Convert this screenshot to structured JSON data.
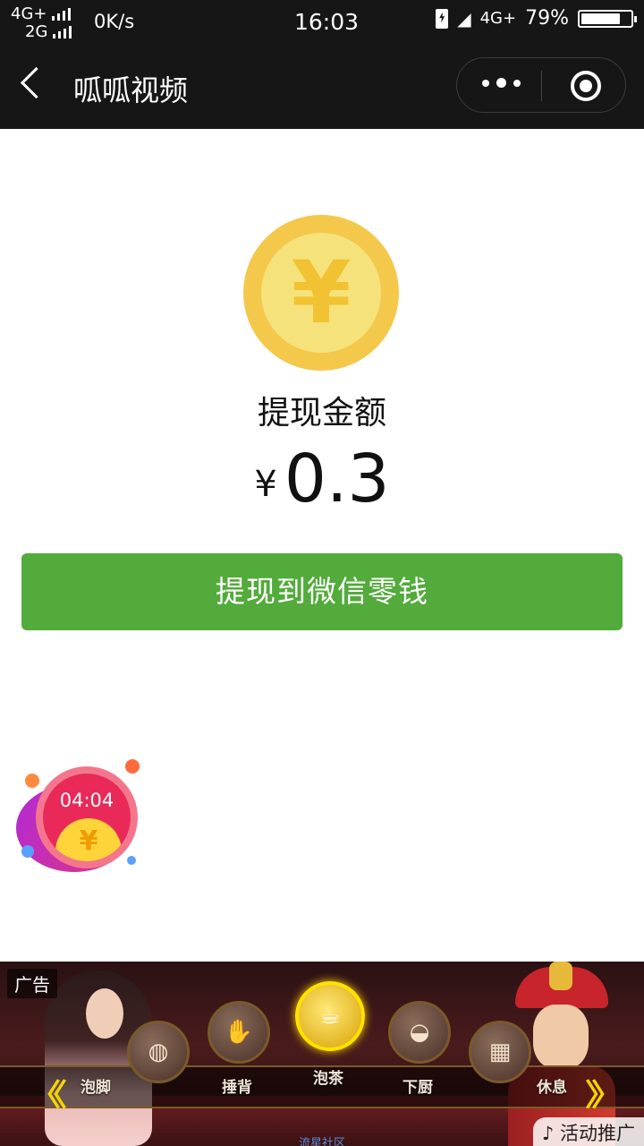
{
  "status_bar": {
    "network_top": "4G+",
    "network_bottom": "2G",
    "speed": "0K/s",
    "time": "16:03",
    "network_right": "4G+",
    "battery_percent": "79%",
    "battery_level": 0.79
  },
  "nav": {
    "title": "呱呱视频",
    "icons": [
      "back-icon",
      "more-icon",
      "close-mini-program-icon"
    ]
  },
  "main": {
    "coin_symbol": "¥",
    "label": "提现金额",
    "currency": "¥",
    "amount": "0.3",
    "withdraw_button": "提现到微信零钱"
  },
  "floating_timer": {
    "time": "04:04",
    "coin_symbol": "¥"
  },
  "ad": {
    "tag": "广告",
    "items": [
      "泡脚",
      "捶背",
      "泡茶",
      "下厨",
      "休息"
    ],
    "selected_item": "泡茶",
    "footer_text": "流星社区",
    "promo_label": "活动推广",
    "colors": {
      "accent": "#52ab3a",
      "coin": "#f4c84b"
    }
  }
}
